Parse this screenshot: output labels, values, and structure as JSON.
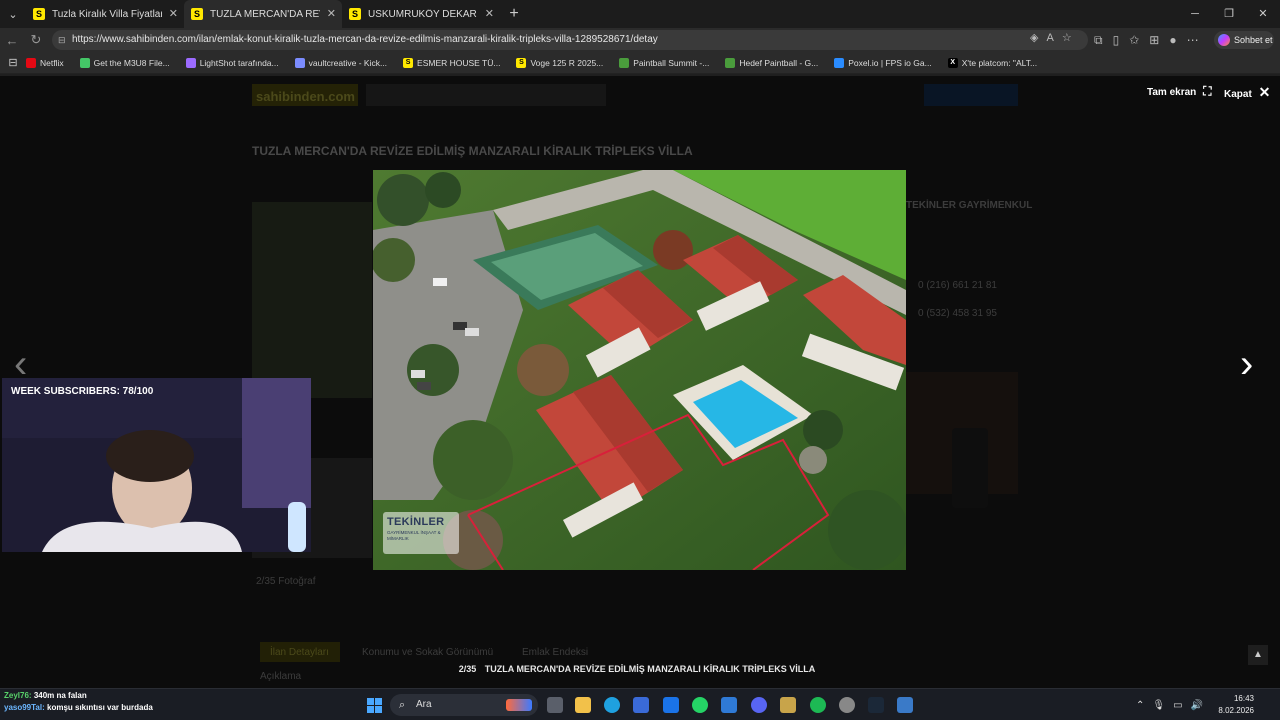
{
  "browser": {
    "tabs": [
      {
        "favicon": "S",
        "label": "Tuzla Kiralık Villa Fiyatları sahibind",
        "close": "✕"
      },
      {
        "favicon": "S",
        "label": "TUZLA MERCAN'DA REVİZE EDİLMİŞ",
        "close": "✕"
      },
      {
        "favicon": "S",
        "label": "USKUMRUKÖY DEKAR BAHÇELİ FE",
        "close": "✕"
      }
    ],
    "new_tab": "+",
    "url": "https://www.sahibinden.com/ilan/emlak-konut-kiralik-tuzla-mercan-da-revize-edilmis-manzarali-kiralik-tripleks-villa-1289528671/detay",
    "copilot_label": "Sohbet et",
    "bookmarks": [
      {
        "label": "Netflix",
        "color": "#e50914",
        "glyph": ""
      },
      {
        "label": "Get the M3U8 File...",
        "color": "#44c767",
        "glyph": ""
      },
      {
        "label": "LightShot tarafında...",
        "color": "#9c6bff",
        "glyph": ""
      },
      {
        "label": "vaultcreative - Kick...",
        "color": "#7b8cff",
        "glyph": ""
      },
      {
        "label": "ESMER HOUSE TÜ...",
        "color": "#ffe800",
        "glyph": "S"
      },
      {
        "label": "Voge 125 R 2025...",
        "color": "#ffe800",
        "glyph": "S"
      },
      {
        "label": "Paintball Summit -...",
        "color": "#4a9c3c",
        "glyph": ""
      },
      {
        "label": "Hedef Paintball - G...",
        "color": "#4a9c3c",
        "glyph": ""
      },
      {
        "label": "Poxel.io | FPS io Ga...",
        "color": "#2a8cff",
        "glyph": ""
      },
      {
        "label": "X'te platcom: \"ALT...",
        "color": "#000000",
        "glyph": "X"
      }
    ]
  },
  "page_behind": {
    "logo": "sahibinden.com",
    "title": "TUZLA MERCAN'DA REVİZE EDİLMİŞ MANZARALI KİRALIK TRİPLEKS VİLLA",
    "agency": "TEKİNLER GAYRİMENKUL",
    "phone1": "0 (216) 661 21 81",
    "phone2": "0 (532) 458 31 95",
    "photo_count": "2/35 Fotoğraf",
    "tabs": [
      "İlan Detayları",
      "Konumu ve Sokak Görünümü",
      "Emlak Endeksi"
    ],
    "desc_label": "Açıklama"
  },
  "lightbox": {
    "fullscreen_label": "Tam ekran",
    "close_label": "Kapat",
    "counter": "2/35",
    "caption": "TUZLA MERCAN'DA REVİZE EDİLMİŞ MANZARALI KİRALIK TRİPLEKS VİLLA",
    "watermark_name": "TEKİNLER",
    "watermark_sub": "GAYRİMENKUL İNŞAAT & MİMARLIK"
  },
  "stream": {
    "subscriber_label": "WEEK SUBSCRIBERS: 78/100",
    "chat": [
      {
        "user": "Zeyl76:",
        "text": "340m na falan"
      },
      {
        "user": "yaso99Tal:",
        "text": "komşu sıkıntısı var burdada"
      }
    ]
  },
  "taskbar": {
    "search_label": "Ara",
    "time": "16:43",
    "date": "8.02.2026"
  },
  "colors": {
    "sahibinden_yellow": "#ffe800",
    "property_line": "#d8203a"
  }
}
